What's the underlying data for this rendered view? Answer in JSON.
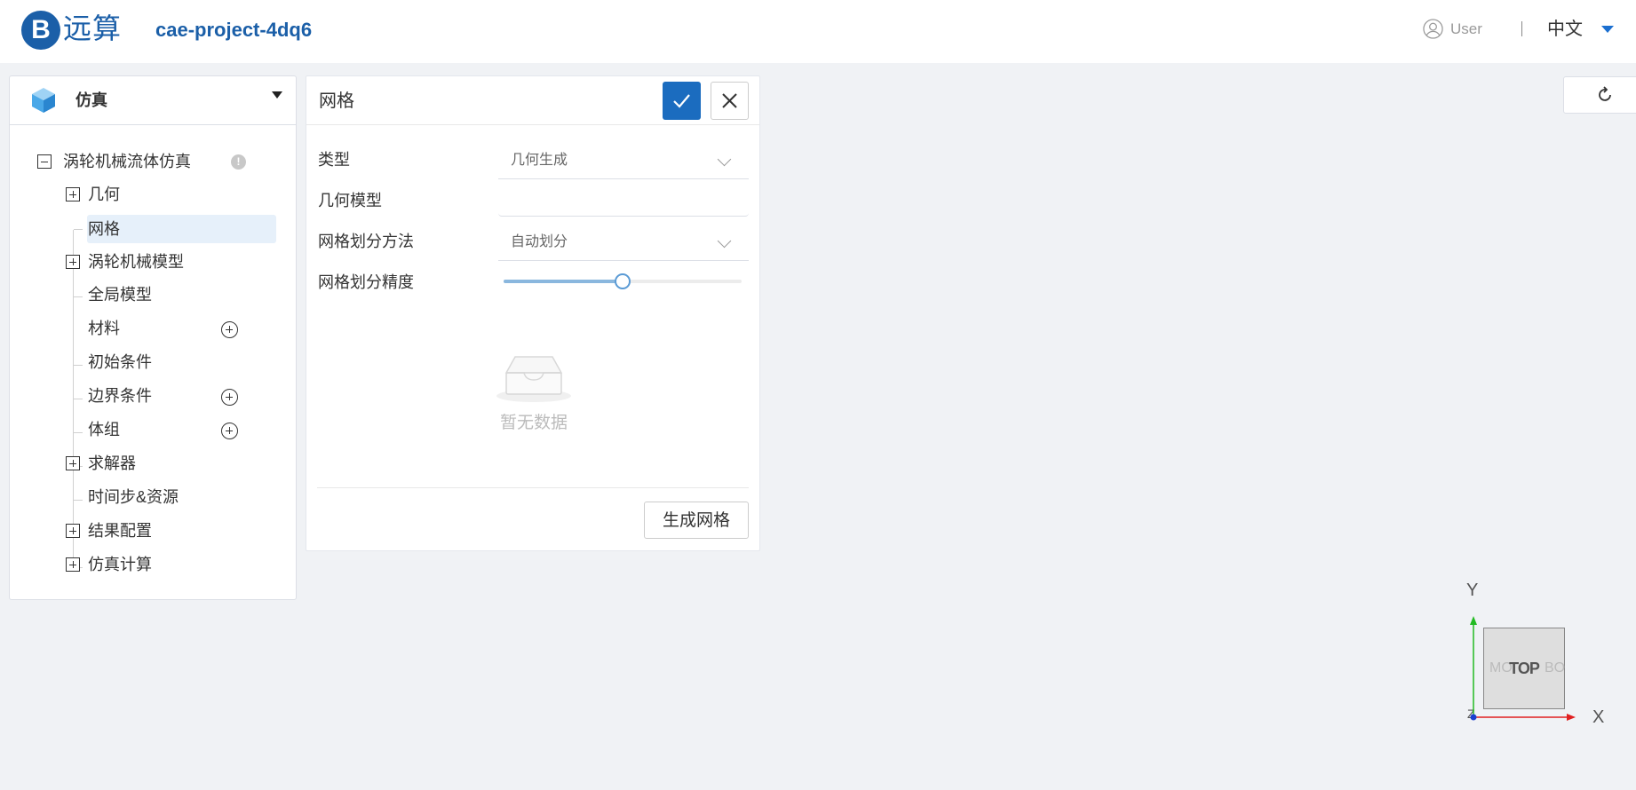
{
  "header": {
    "logo_glyph": "B",
    "brand": "远算",
    "project": "cae-project-4dq6",
    "user": "User",
    "language": "中文"
  },
  "sidebar": {
    "title": "仿真",
    "tree": [
      {
        "label": "涡轮机械流体仿真",
        "level": 0,
        "toggle": "minus",
        "info": true
      },
      {
        "label": "几何",
        "level": 1,
        "toggle": "plus"
      },
      {
        "label": "网格",
        "level": 1,
        "selected": true
      },
      {
        "label": "涡轮机械模型",
        "level": 1,
        "toggle": "plus"
      },
      {
        "label": "全局模型",
        "level": 1
      },
      {
        "label": "材料",
        "level": 1,
        "add": true
      },
      {
        "label": "初始条件",
        "level": 1
      },
      {
        "label": "边界条件",
        "level": 1,
        "add": true
      },
      {
        "label": "体组",
        "level": 1,
        "add": true
      },
      {
        "label": "求解器",
        "level": 1,
        "toggle": "plus"
      },
      {
        "label": "时间步&资源",
        "level": 1
      },
      {
        "label": "结果配置",
        "level": 1,
        "toggle": "plus"
      },
      {
        "label": "仿真计算",
        "level": 1,
        "toggle": "plus"
      }
    ],
    "info_glyph": "!"
  },
  "panel": {
    "title": "网格",
    "fields": {
      "type_label": "类型",
      "type_value": "几何生成",
      "model_label": "几何模型",
      "model_value": "",
      "method_label": "网格划分方法",
      "method_value": "自动划分",
      "precision_label": "网格划分精度"
    },
    "precision_fraction": 0.5,
    "empty_text": "暂无数据",
    "generate_button": "生成网格"
  },
  "viewport": {
    "axis_y": "Y",
    "axis_x": "X",
    "axis_z": "Z",
    "cube_face": "TOP",
    "cube_ghost_left": "MO",
    "cube_ghost_right": "BO",
    "colors": {
      "x_axis": "#e02020",
      "y_axis": "#22bb22",
      "z_axis": "#1a3fd0"
    }
  },
  "colors": {
    "primary": "#1b6cbf",
    "brand": "#1b5fa8",
    "selected_bg": "#e6f0fa"
  }
}
